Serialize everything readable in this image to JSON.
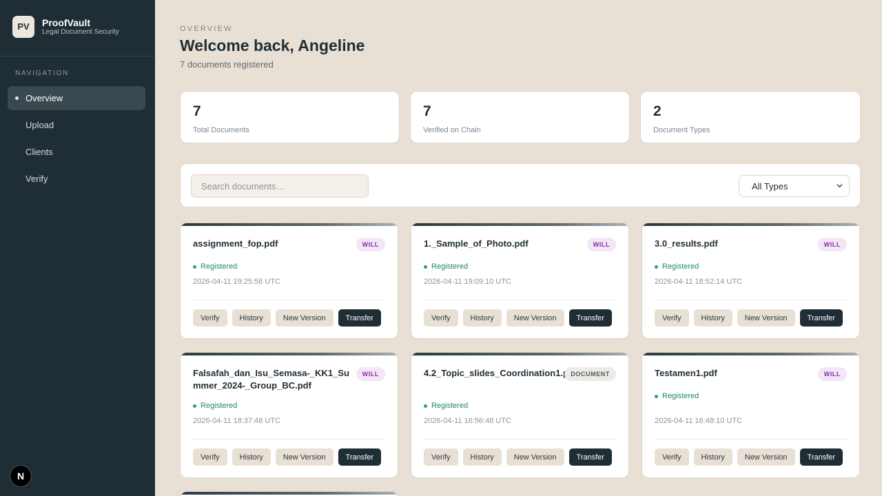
{
  "sidebar": {
    "brand_initials": "PV",
    "brand_name": "ProofVault",
    "brand_subtitle": "Legal Document Security",
    "nav_heading": "NAVIGATION",
    "items": [
      {
        "label": "Overview",
        "active": true
      },
      {
        "label": "Upload",
        "active": false
      },
      {
        "label": "Clients",
        "active": false
      },
      {
        "label": "Verify",
        "active": false
      }
    ],
    "badge_letter": "N"
  },
  "header": {
    "eyebrow": "OVERVIEW",
    "title": "Welcome back, Angeline",
    "subtitle": "7 documents registered"
  },
  "stats": [
    {
      "value": "7",
      "label": "Total Documents"
    },
    {
      "value": "7",
      "label": "Verified on Chain"
    },
    {
      "value": "2",
      "label": "Document Types"
    }
  ],
  "search": {
    "placeholder": "Search documents…"
  },
  "filter": {
    "selected": "All Types"
  },
  "actions": {
    "verify": "Verify",
    "history": "History",
    "new_version": "New Version",
    "transfer": "Transfer"
  },
  "documents": [
    {
      "name": "assignment_fop.pdf",
      "type": "WILL",
      "status": "Registered",
      "timestamp": "2026-04-11 19:25:56 UTC"
    },
    {
      "name": "1._Sample_of_Photo.pdf",
      "type": "WILL",
      "status": "Registered",
      "timestamp": "2026-04-11 19:09:10 UTC"
    },
    {
      "name": "3.0_results.pdf",
      "type": "WILL",
      "status": "Registered",
      "timestamp": "2026-04-11 18:52:14 UTC"
    },
    {
      "name": "Falsafah_dan_Isu_Semasa-_KK1_Summer_2024-_Group_BC.pdf",
      "type": "WILL",
      "status": "Registered",
      "timestamp": "2026-04-11 18:37:48 UTC"
    },
    {
      "name": "4.2_Topic_slides_Coordination1.pdf",
      "type": "DOCUMENT",
      "status": "Registered",
      "timestamp": "2026-04-11 16:56:48 UTC"
    },
    {
      "name": "Testamen1.pdf",
      "type": "WILL",
      "status": "Registered",
      "timestamp": "2026-04-11 16:48:10 UTC"
    }
  ],
  "colors": {
    "sidebar": "#1f2d35",
    "background": "#e8e0d5",
    "accent_dark": "#1f2d35",
    "status_green": "#1fa56b",
    "will_badge": "#8a2aa8"
  }
}
